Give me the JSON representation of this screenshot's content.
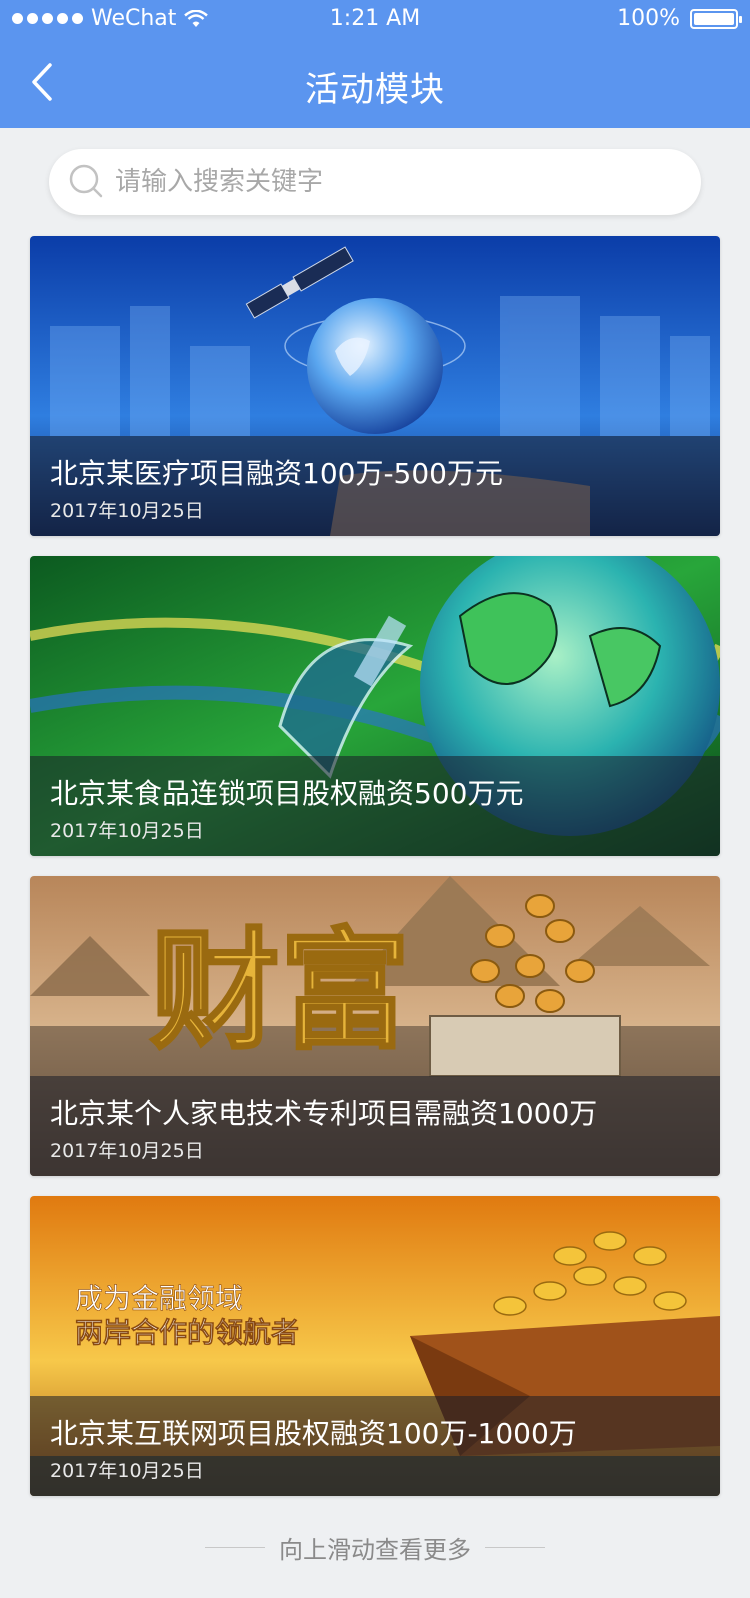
{
  "status_bar": {
    "carrier": "WeChat",
    "time": "1:21 AM",
    "battery": "100%"
  },
  "nav": {
    "title": "活动模块"
  },
  "search": {
    "placeholder": "请输入搜索关键字"
  },
  "cards": [
    {
      "title": "北京某医疗项目融资100万-500万元",
      "date": "2017年10月25日"
    },
    {
      "title": "北京某食品连锁项目股权融资500万元",
      "date": "2017年10月25日"
    },
    {
      "title": "北京某个人家电技术专利项目需融资1000万",
      "date": "2017年10月25日",
      "art_text": "财富"
    },
    {
      "title": "北京某互联网项目股权融资100万-1000万",
      "date": "2017年10月25日",
      "art_text_1": "成为金融领域",
      "art_text_2": "两岸合作的领航者"
    }
  ],
  "footer": {
    "hint": "向上滑动查看更多"
  },
  "colors": {
    "primary": "#5b95ef",
    "background": "#eef0f2"
  }
}
